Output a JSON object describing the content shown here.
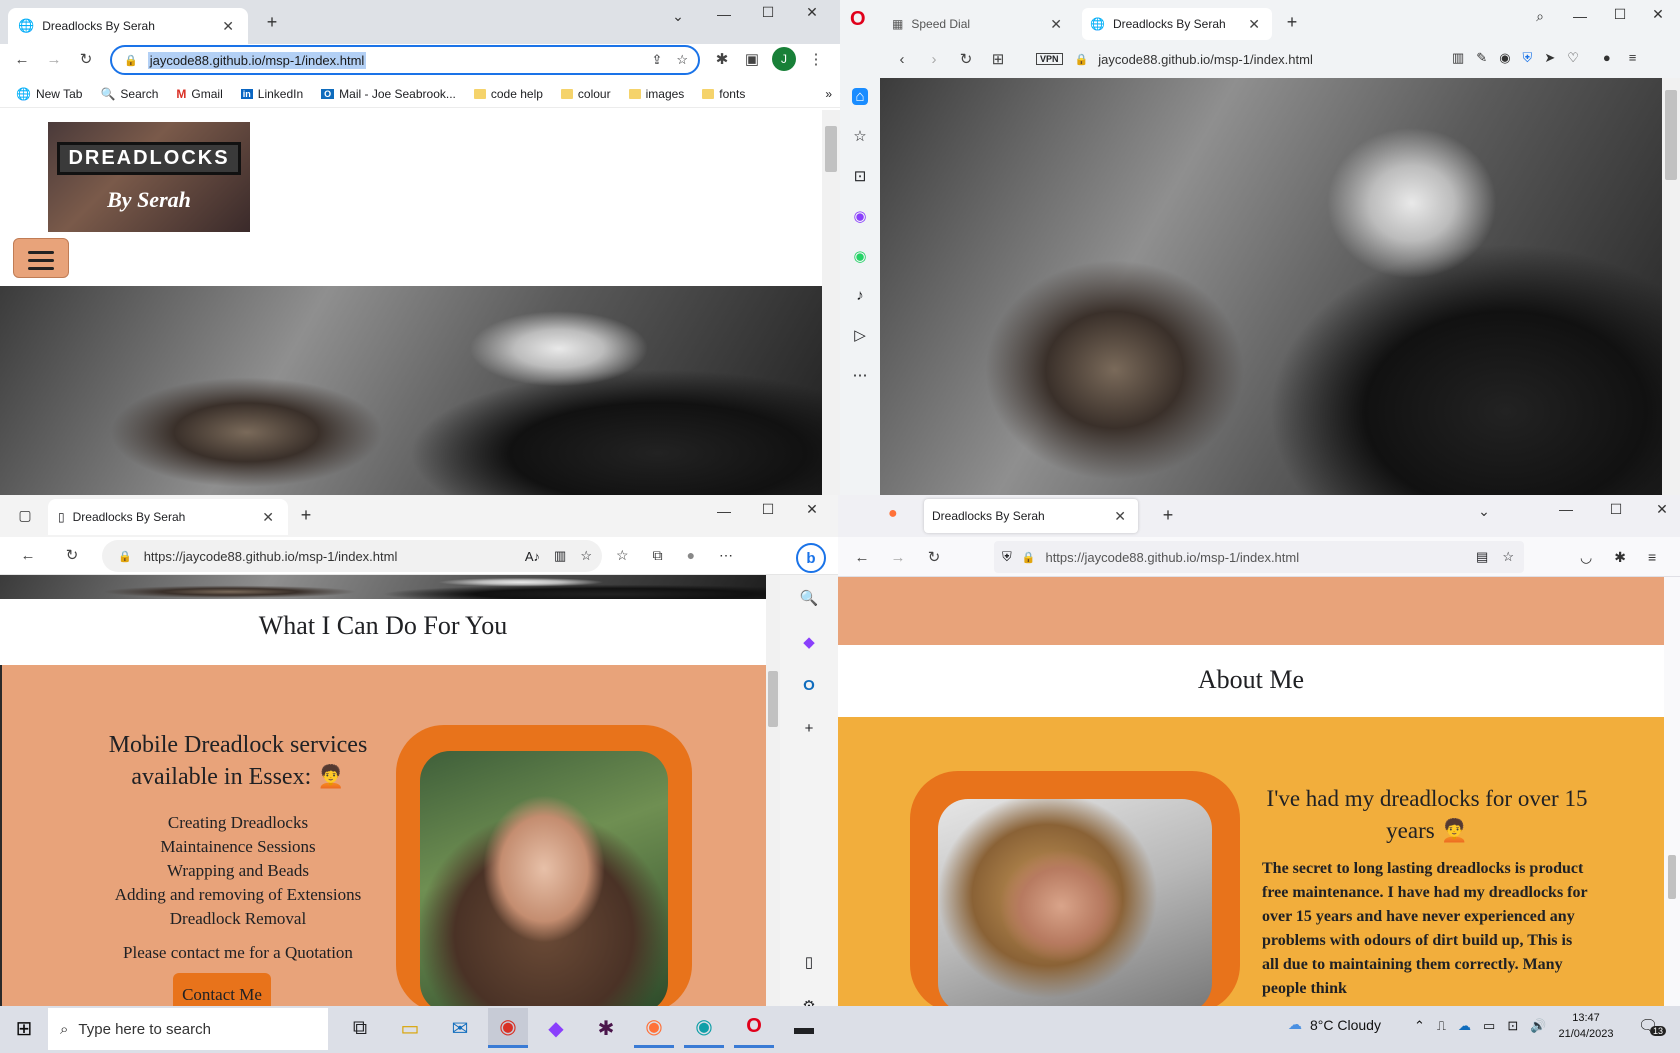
{
  "chrome": {
    "tab_title": "Dreadlocks By Serah",
    "url": "jaycode88.github.io/msp-1/index.html",
    "profile_initial": "J",
    "bookmarks": [
      "New Tab",
      "Search",
      "Gmail",
      "LinkedIn",
      "Mail - Joe Seabrook...",
      "code help",
      "colour",
      "images",
      "fonts"
    ],
    "logo_line1": "DREADLOCKS",
    "logo_line2": "By Serah"
  },
  "opera": {
    "tab1": "Speed Dial",
    "tab2": "Dreadlocks By Serah",
    "vpn": "VPN",
    "url": "jaycode88.github.io/msp-1/index.html"
  },
  "edge": {
    "tab_title": "Dreadlocks By Serah",
    "url": "https://jaycode88.github.io/msp-1/index.html",
    "heading": "What I Can Do For You",
    "services_title": "Mobile Dreadlock services available in Essex:",
    "services": [
      "Creating Dreadlocks",
      "Maintainence Sessions",
      "Wrapping and Beads",
      "Adding and removing of Extensions",
      "Dreadlock Removal"
    ],
    "quote_text": "Please contact me for a Quotation",
    "contact_button": "Contact Me"
  },
  "firefox": {
    "tab_title": "Dreadlocks By Serah",
    "url": "https://jaycode88.github.io/msp-1/index.html",
    "heading": "About Me",
    "about_title": "I've had my dreadlocks for over 15 years",
    "about_text": "The secret to long lasting dreadlocks is product free maintenance. I have had my dreadlocks for over 15 years and have never experienced any problems with odours of dirt build up, This is all due to maintaining them correctly. Many people think"
  },
  "taskbar": {
    "search_placeholder": "Type here to search",
    "weather": "8°C  Cloudy",
    "time": "13:47",
    "date": "21/04/2023",
    "notification_count": "13"
  },
  "colors": {
    "salmon": "#e8a37a",
    "orange": "#e8731b",
    "gold": "#f2ae3c",
    "chrome_frame": "#dee1e6",
    "opera_frame": "#f1f3f5",
    "edge_frame": "#f3f3f3",
    "taskbar": "#dcdfe7"
  }
}
